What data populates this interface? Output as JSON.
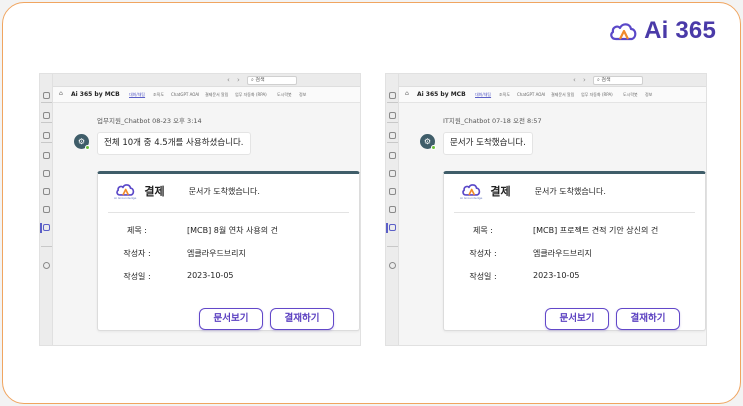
{
  "brand": {
    "name": "Ai 365",
    "color": "#4a3aa8"
  },
  "panels": [
    {
      "search": "검색",
      "app_title": "Ai 365 by MCB",
      "tabs": [
        "대화/채팅",
        "조직도",
        "ChatGPT AOAI",
        "결제문서 알림",
        "업무 자동화 (RPA)",
        "도시락봇",
        "정보"
      ],
      "sender": "업무지원_Chatbot  08-23 오후 3:14",
      "message": "전체 10개 중 4.5개를 사용하셨습니다.",
      "card": {
        "title": "결제",
        "logo_sub": "Ai Groundedge",
        "message": "문서가 도착했습니다.",
        "fields": [
          {
            "label": "제목 :",
            "value": "[MCB] 8월 연차 사용의 건"
          },
          {
            "label": "작성자 :",
            "value": "엠클라우드브리지"
          },
          {
            "label": "작성일 :",
            "value": "2023-10-05"
          }
        ],
        "btn_view": "문서보기",
        "btn_approve": "결재하기"
      }
    },
    {
      "search": "검색",
      "app_title": "Ai 365 by MCB",
      "tabs": [
        "대화/채팅",
        "조직도",
        "ChatGPT AOAI",
        "결제문서 알림",
        "업무 자동화 (RPA)",
        "도시락봇",
        "정보"
      ],
      "sender": "IT지원_Chatbot  07-18 오전 8:57",
      "message": "문서가 도착했습니다.",
      "card": {
        "title": "결제",
        "logo_sub": "Ai Groundedge",
        "message": "문서가 도착했습니다.",
        "fields": [
          {
            "label": "제목 :",
            "value": "[MCB] 프로젝트 견적 기안 상신의 건"
          },
          {
            "label": "작성자 :",
            "value": "엠클라우드브리지"
          },
          {
            "label": "작성일 :",
            "value": "2023-10-05"
          }
        ],
        "btn_view": "문서보기",
        "btn_approve": "결재하기"
      }
    }
  ]
}
